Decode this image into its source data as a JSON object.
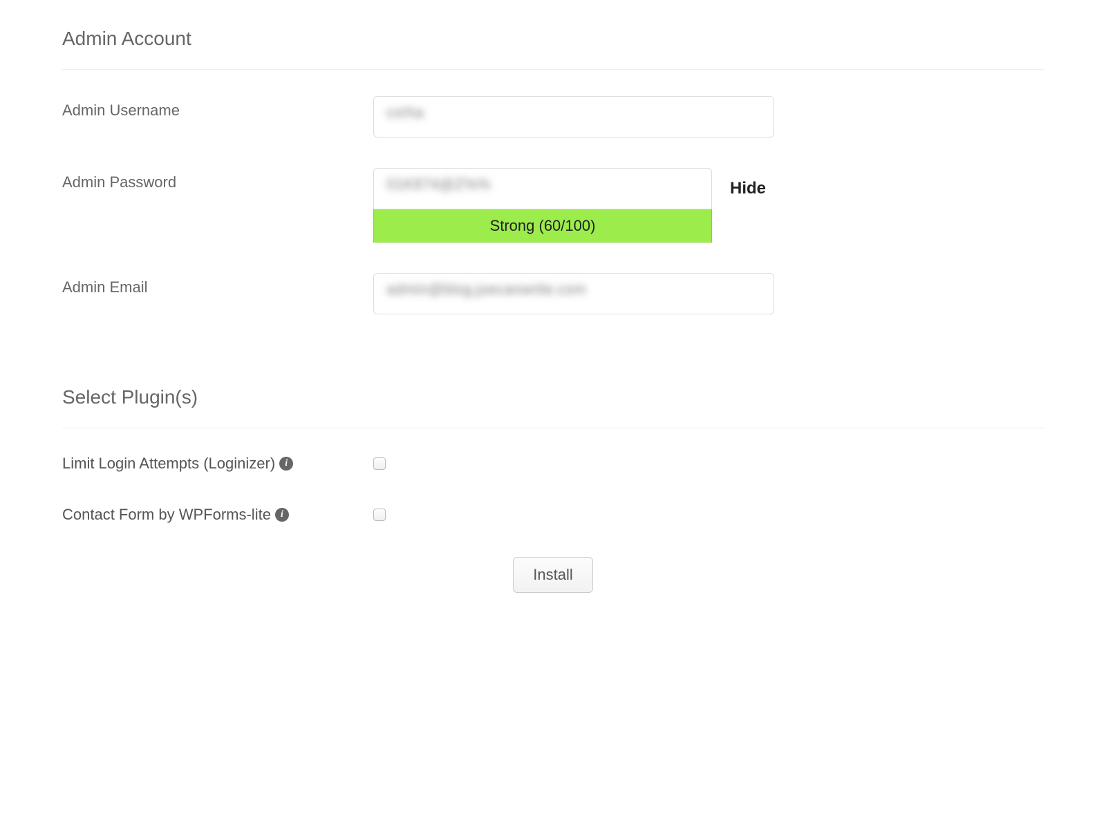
{
  "admin_section": {
    "title": "Admin Account",
    "username": {
      "label": "Admin Username",
      "value": "cxrha"
    },
    "password": {
      "label": "Admin Password",
      "value": "01K874@Z%%",
      "toggle_label": "Hide",
      "strength_text": "Strong (60/100)",
      "strength_color": "#9cec4c"
    },
    "email": {
      "label": "Admin Email",
      "value": "admin@blog.joecanwrite.com"
    }
  },
  "plugins_section": {
    "title": "Select Plugin(s)",
    "items": [
      {
        "label": "Limit Login Attempts (Loginizer)",
        "checked": false
      },
      {
        "label": "Contact Form by WPForms-lite",
        "checked": false
      }
    ]
  },
  "install_button_label": "Install"
}
